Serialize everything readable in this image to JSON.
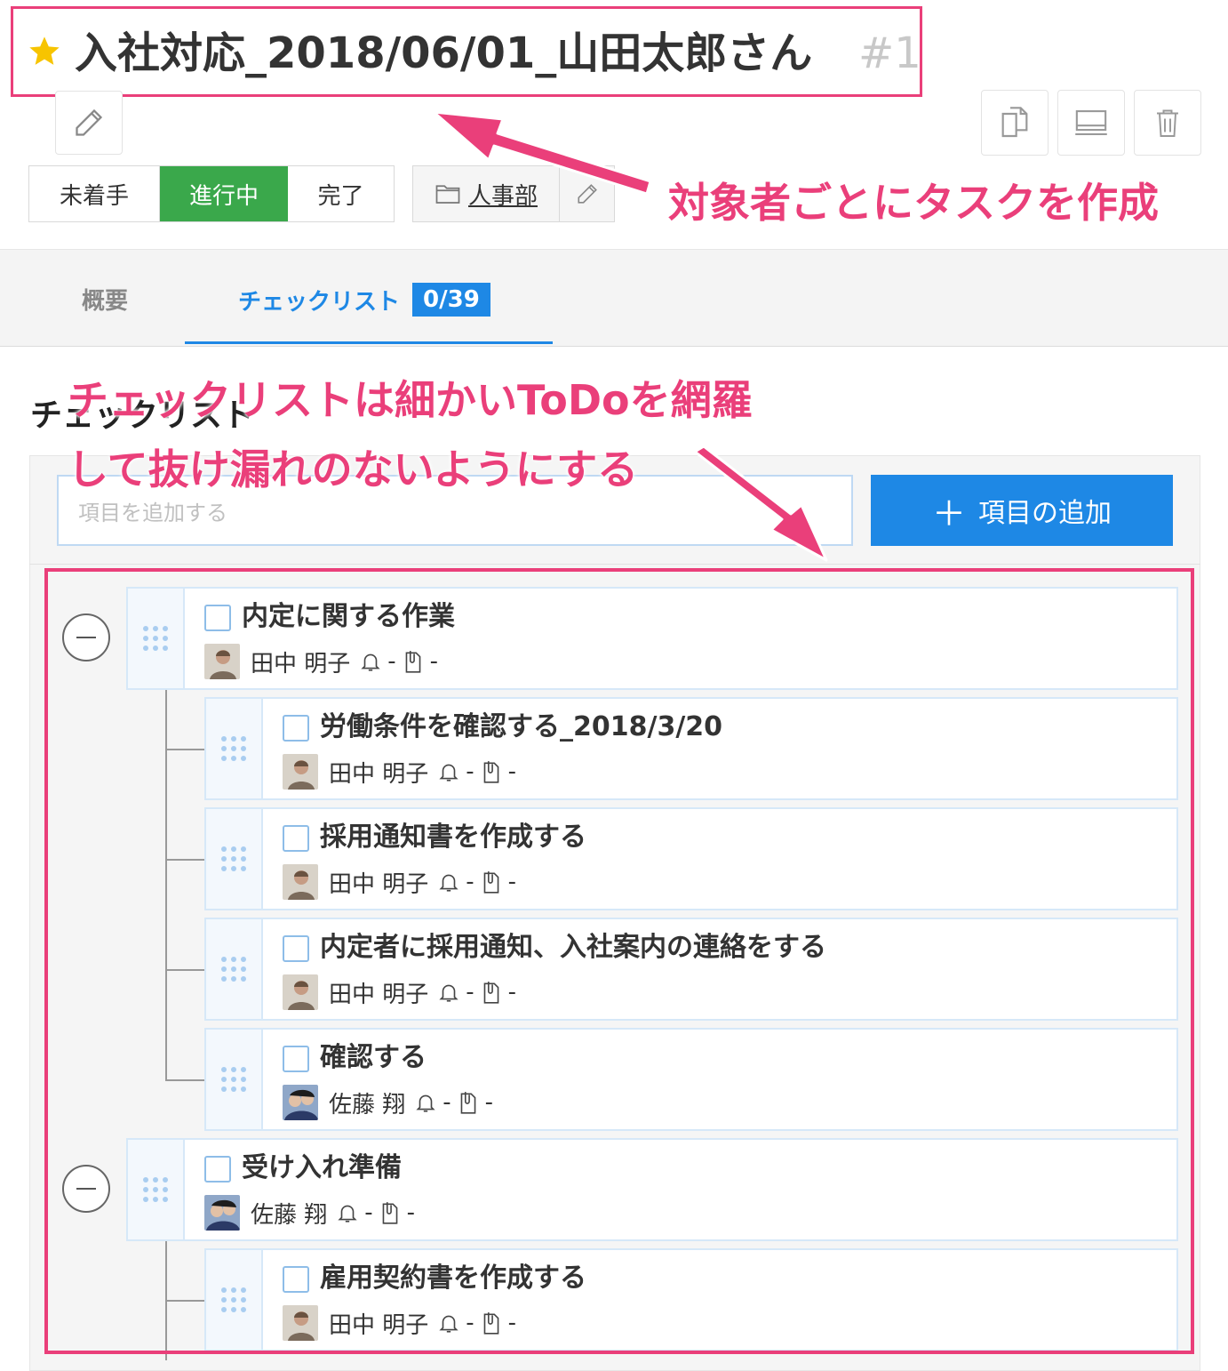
{
  "task": {
    "title": "入社対応_2018/06/01_山田太郎さん",
    "number": "#1"
  },
  "status": {
    "options": [
      "未着手",
      "進行中",
      "完了"
    ],
    "selected": "進行中",
    "active_color": "#3aa84b"
  },
  "folder": {
    "label": "人事部"
  },
  "tabs": {
    "overview": "概要",
    "checklist": "チェックリスト",
    "checklist_badge": "0/39"
  },
  "section_title": "チェックリスト",
  "annotations": {
    "title_note": "対象者ごとにタスクを作成",
    "list_note_line1": "チェックリストは細かいToDoを網羅",
    "list_note_line2": "して抜け漏れのないようにする",
    "color": "#ea3f7a"
  },
  "add_item": {
    "placeholder": "項目を追加する",
    "button_label": "項目の追加"
  },
  "items": [
    {
      "title": "内定に関する作業",
      "assignee": "田中 明子",
      "reminder": "-",
      "attachment": "-",
      "level": 0
    },
    {
      "title": "労働条件を確認する_2018/3/20",
      "assignee": "田中 明子",
      "reminder": "-",
      "attachment": "-",
      "level": 1
    },
    {
      "title": "採用通知書を作成する",
      "assignee": "田中 明子",
      "reminder": "-",
      "attachment": "-",
      "level": 1
    },
    {
      "title": "内定者に採用通知、入社案内の連絡をする",
      "assignee": "田中 明子",
      "reminder": "-",
      "attachment": "-",
      "level": 1
    },
    {
      "title": "確認する",
      "assignee": "佐藤 翔",
      "reminder": "-",
      "attachment": "-",
      "level": 1
    },
    {
      "title": "受け入れ準備",
      "assignee": "佐藤 翔",
      "reminder": "-",
      "attachment": "-",
      "level": 0
    },
    {
      "title": "雇用契約書を作成する",
      "assignee": "田中 明子",
      "reminder": "-",
      "attachment": "-",
      "level": 1
    }
  ],
  "colors": {
    "accent": "#1e88e5",
    "annotation": "#ea3f7a",
    "star": "#f7c400"
  },
  "icons": {
    "title_star": "star-icon",
    "edit": "pencil-icon",
    "copy": "copy-icon",
    "display": "monitor-icon",
    "delete": "trash-icon",
    "folder": "folder-icon",
    "reminder": "bell-icon",
    "attachment": "clip-icon",
    "drag": "drag-handle-icon",
    "collapse": "collapse-minus-icon"
  }
}
